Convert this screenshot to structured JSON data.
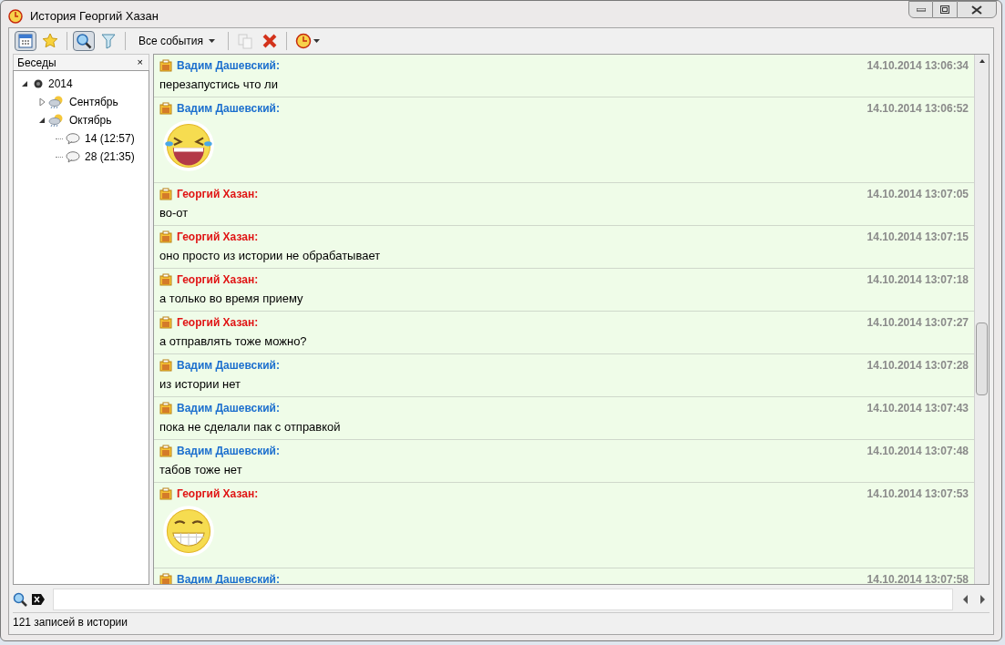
{
  "window": {
    "title": "История Георгий Хазан"
  },
  "toolbar": [
    {
      "kind": "calendar",
      "on": true
    },
    {
      "kind": "star",
      "on": false
    },
    {
      "kind": "search",
      "on": true
    },
    {
      "kind": "filter",
      "on": false
    },
    {
      "kind": "dropdown",
      "label": "Все события"
    },
    {
      "kind": "copy",
      "disabled": true
    },
    {
      "kind": "delete",
      "disabled": false
    },
    {
      "kind": "clock-menu",
      "disabled": false
    }
  ],
  "sidebar": {
    "title": "Беседы",
    "close": "×",
    "tree": [
      {
        "label": "2014",
        "expanded": true,
        "children": [
          {
            "label": "Сентябрь",
            "expanded": false
          },
          {
            "label": "Октябрь",
            "expanded": true,
            "children": [
              {
                "label": "14 (12:57)"
              },
              {
                "label": "28 (21:35)"
              }
            ]
          }
        ]
      }
    ]
  },
  "messages": [
    {
      "sender": "Вадим Дашевский:",
      "color": "#1c6fce",
      "time": "14.10.2014 13:06:34",
      "kind": "text",
      "text": "перезапустись что ли"
    },
    {
      "sender": "Вадим Дашевский:",
      "color": "#1c6fce",
      "time": "14.10.2014 13:06:52",
      "kind": "laughing"
    },
    {
      "sender": "Георгий Хазан:",
      "color": "#e01414",
      "time": "14.10.2014 13:07:05",
      "kind": "text",
      "text": "во-от"
    },
    {
      "sender": "Георгий Хазан:",
      "color": "#e01414",
      "time": "14.10.2014 13:07:15",
      "kind": "text",
      "text": "оно просто из истории не обрабатывает"
    },
    {
      "sender": "Георгий Хазан:",
      "color": "#e01414",
      "time": "14.10.2014 13:07:18",
      "kind": "text",
      "text": "а только во время приему"
    },
    {
      "sender": "Георгий Хазан:",
      "color": "#e01414",
      "time": "14.10.2014 13:07:27",
      "kind": "text",
      "text": "а отправлять тоже можно?"
    },
    {
      "sender": "Вадим Дашевский:",
      "color": "#1c6fce",
      "time": "14.10.2014 13:07:28",
      "kind": "text",
      "text": "из истории нет"
    },
    {
      "sender": "Вадим Дашевский:",
      "color": "#1c6fce",
      "time": "14.10.2014 13:07:43",
      "kind": "text",
      "text": "пока не сделали пак с отправкой"
    },
    {
      "sender": "Вадим Дашевский:",
      "color": "#1c6fce",
      "time": "14.10.2014 13:07:48",
      "kind": "text",
      "text": "табов тоже нет"
    },
    {
      "sender": "Георгий Хазан:",
      "color": "#e01414",
      "time": "14.10.2014 13:07:53",
      "kind": "grinning"
    },
    {
      "sender": "Вадим Дашевский:",
      "color": "#1c6fce",
      "time": "14.10.2014 13:07:58",
      "kind": "header"
    }
  ],
  "status_bar": "121 записей в истории"
}
